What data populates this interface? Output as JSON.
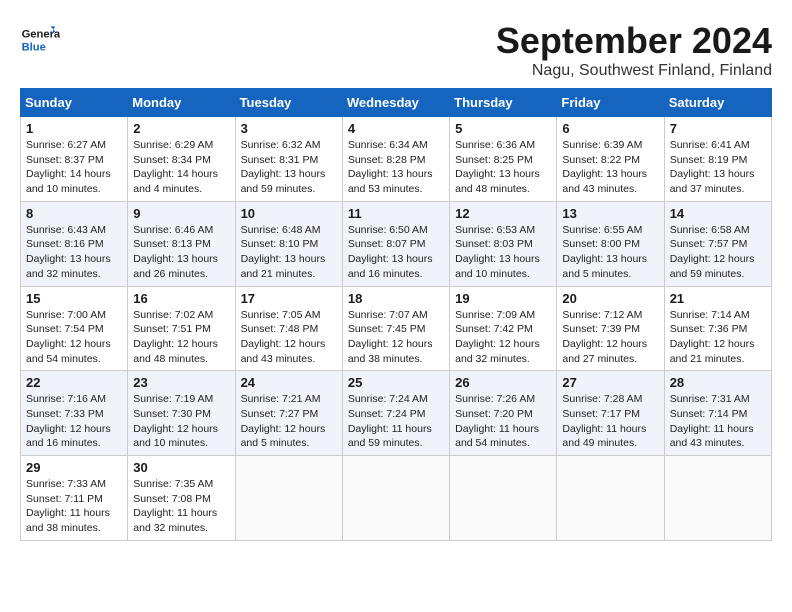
{
  "logo": {
    "line1": "General",
    "line2": "Blue"
  },
  "title": "September 2024",
  "location": "Nagu, Southwest Finland, Finland",
  "weekdays": [
    "Sunday",
    "Monday",
    "Tuesday",
    "Wednesday",
    "Thursday",
    "Friday",
    "Saturday"
  ],
  "weeks": [
    [
      {
        "day": "1",
        "sunrise": "6:27 AM",
        "sunset": "8:37 PM",
        "daylight": "14 hours and 10 minutes."
      },
      {
        "day": "2",
        "sunrise": "6:29 AM",
        "sunset": "8:34 PM",
        "daylight": "14 hours and 4 minutes."
      },
      {
        "day": "3",
        "sunrise": "6:32 AM",
        "sunset": "8:31 PM",
        "daylight": "13 hours and 59 minutes."
      },
      {
        "day": "4",
        "sunrise": "6:34 AM",
        "sunset": "8:28 PM",
        "daylight": "13 hours and 53 minutes."
      },
      {
        "day": "5",
        "sunrise": "6:36 AM",
        "sunset": "8:25 PM",
        "daylight": "13 hours and 48 minutes."
      },
      {
        "day": "6",
        "sunrise": "6:39 AM",
        "sunset": "8:22 PM",
        "daylight": "13 hours and 43 minutes."
      },
      {
        "day": "7",
        "sunrise": "6:41 AM",
        "sunset": "8:19 PM",
        "daylight": "13 hours and 37 minutes."
      }
    ],
    [
      {
        "day": "8",
        "sunrise": "6:43 AM",
        "sunset": "8:16 PM",
        "daylight": "13 hours and 32 minutes."
      },
      {
        "day": "9",
        "sunrise": "6:46 AM",
        "sunset": "8:13 PM",
        "daylight": "13 hours and 26 minutes."
      },
      {
        "day": "10",
        "sunrise": "6:48 AM",
        "sunset": "8:10 PM",
        "daylight": "13 hours and 21 minutes."
      },
      {
        "day": "11",
        "sunrise": "6:50 AM",
        "sunset": "8:07 PM",
        "daylight": "13 hours and 16 minutes."
      },
      {
        "day": "12",
        "sunrise": "6:53 AM",
        "sunset": "8:03 PM",
        "daylight": "13 hours and 10 minutes."
      },
      {
        "day": "13",
        "sunrise": "6:55 AM",
        "sunset": "8:00 PM",
        "daylight": "13 hours and 5 minutes."
      },
      {
        "day": "14",
        "sunrise": "6:58 AM",
        "sunset": "7:57 PM",
        "daylight": "12 hours and 59 minutes."
      }
    ],
    [
      {
        "day": "15",
        "sunrise": "7:00 AM",
        "sunset": "7:54 PM",
        "daylight": "12 hours and 54 minutes."
      },
      {
        "day": "16",
        "sunrise": "7:02 AM",
        "sunset": "7:51 PM",
        "daylight": "12 hours and 48 minutes."
      },
      {
        "day": "17",
        "sunrise": "7:05 AM",
        "sunset": "7:48 PM",
        "daylight": "12 hours and 43 minutes."
      },
      {
        "day": "18",
        "sunrise": "7:07 AM",
        "sunset": "7:45 PM",
        "daylight": "12 hours and 38 minutes."
      },
      {
        "day": "19",
        "sunrise": "7:09 AM",
        "sunset": "7:42 PM",
        "daylight": "12 hours and 32 minutes."
      },
      {
        "day": "20",
        "sunrise": "7:12 AM",
        "sunset": "7:39 PM",
        "daylight": "12 hours and 27 minutes."
      },
      {
        "day": "21",
        "sunrise": "7:14 AM",
        "sunset": "7:36 PM",
        "daylight": "12 hours and 21 minutes."
      }
    ],
    [
      {
        "day": "22",
        "sunrise": "7:16 AM",
        "sunset": "7:33 PM",
        "daylight": "12 hours and 16 minutes."
      },
      {
        "day": "23",
        "sunrise": "7:19 AM",
        "sunset": "7:30 PM",
        "daylight": "12 hours and 10 minutes."
      },
      {
        "day": "24",
        "sunrise": "7:21 AM",
        "sunset": "7:27 PM",
        "daylight": "12 hours and 5 minutes."
      },
      {
        "day": "25",
        "sunrise": "7:24 AM",
        "sunset": "7:24 PM",
        "daylight": "11 hours and 59 minutes."
      },
      {
        "day": "26",
        "sunrise": "7:26 AM",
        "sunset": "7:20 PM",
        "daylight": "11 hours and 54 minutes."
      },
      {
        "day": "27",
        "sunrise": "7:28 AM",
        "sunset": "7:17 PM",
        "daylight": "11 hours and 49 minutes."
      },
      {
        "day": "28",
        "sunrise": "7:31 AM",
        "sunset": "7:14 PM",
        "daylight": "11 hours and 43 minutes."
      }
    ],
    [
      {
        "day": "29",
        "sunrise": "7:33 AM",
        "sunset": "7:11 PM",
        "daylight": "11 hours and 38 minutes."
      },
      {
        "day": "30",
        "sunrise": "7:35 AM",
        "sunset": "7:08 PM",
        "daylight": "11 hours and 32 minutes."
      },
      null,
      null,
      null,
      null,
      null
    ]
  ]
}
